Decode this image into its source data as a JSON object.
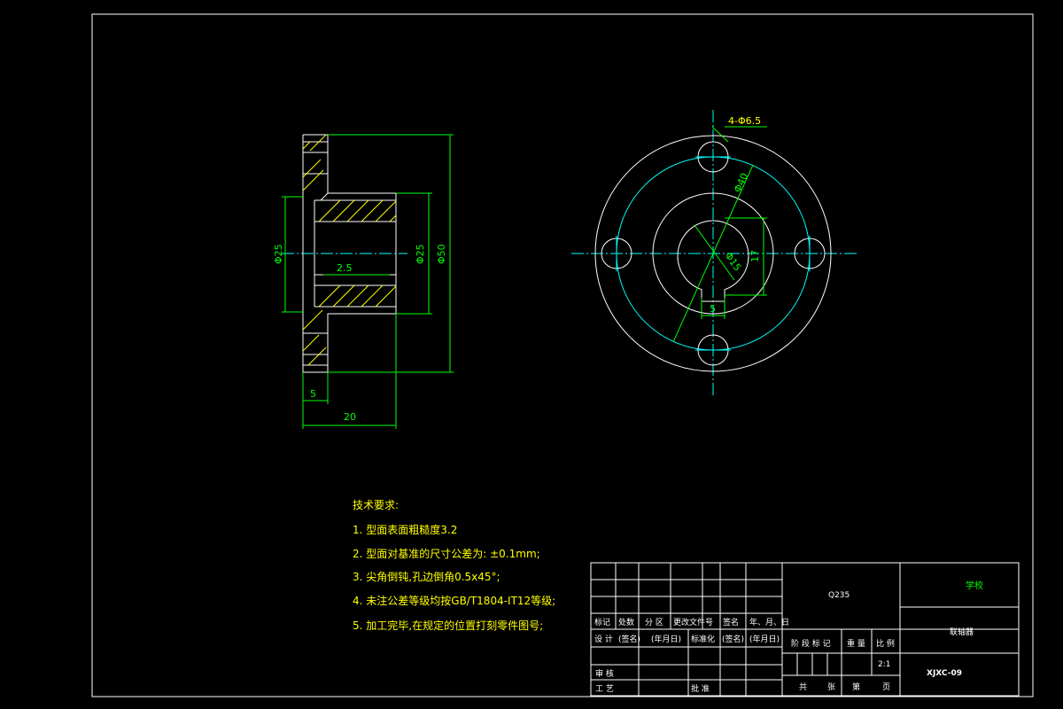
{
  "dimensions": {
    "side_bore": "Φ25",
    "side_hub": "Φ25",
    "side_flange": "Φ50",
    "chamfer": "2.5",
    "flange_thickness": "5",
    "total_length": "20",
    "holes": "4-Φ6.5",
    "pcd": "Φ40",
    "bore": "Φ15",
    "key_depth": "17",
    "key_width": "5"
  },
  "tech_requirements": {
    "title": "技术要求:",
    "items": [
      "1. 型面表面粗糙度3.2",
      "2. 型面对基准的尺寸公差为: ±0.1mm;",
      "3. 尖角倒钝,孔边倒角0.5x45°;",
      "4. 未注公差等级均按GB/T1804-IT12等级;",
      "5. 加工完毕,在规定的位置打刻零件图号;"
    ]
  },
  "title_block": {
    "material": "Q235",
    "school": "学校",
    "part_name": "联轴器",
    "drawing_no": "XJXC-09",
    "scale": "2:1",
    "rev_headers": [
      "标记",
      "处数",
      "分 区",
      "更改文件号",
      "签名",
      "年、月、日"
    ],
    "design_row": [
      "设 计",
      "(签名)",
      "(年月日)",
      "标准化",
      "(签名)",
      "(年月日)"
    ],
    "review": "审 核",
    "process": "工 艺",
    "approve": "批 准",
    "stage_headers": [
      "阶 段 标 记",
      "重 量",
      "比 例"
    ],
    "sheet_row": [
      "共",
      "张",
      "第",
      "页"
    ]
  }
}
